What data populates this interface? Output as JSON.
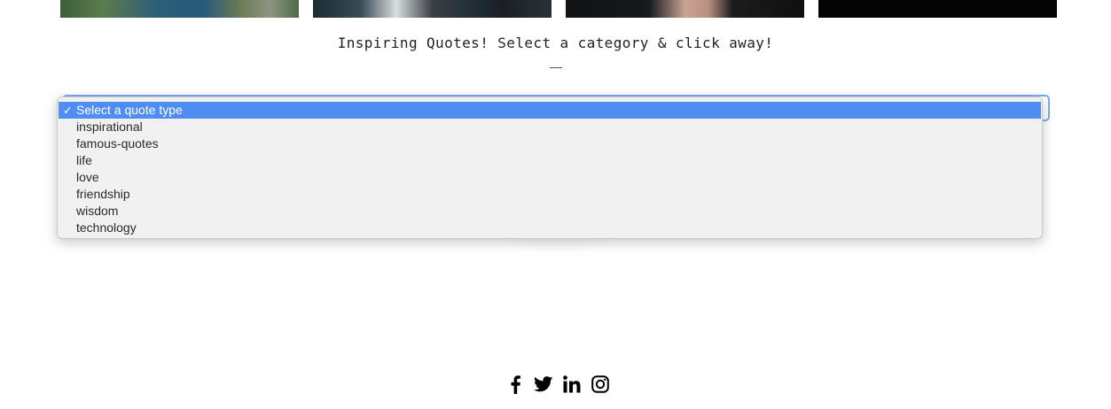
{
  "tagline": {
    "text": "Inspiring Quotes! Select a category & click away!",
    "rule": "—"
  },
  "quote_select": {
    "selected_label": "Select a quote type",
    "check_glyph": "✓",
    "options": [
      "Select a quote type",
      "inspirational",
      "famous-quotes",
      "life",
      "love",
      "friendship",
      "wisdom",
      "technology"
    ],
    "highlight_color": "#4f8ef0"
  },
  "gallery": {
    "thumbnails": [
      "thumbnail-coast",
      "thumbnail-rocks",
      "thumbnail-portrait",
      "thumbnail-dark"
    ]
  },
  "social": {
    "icons": [
      "facebook-icon",
      "twitter-icon",
      "linkedin-icon",
      "instagram-icon"
    ]
  }
}
